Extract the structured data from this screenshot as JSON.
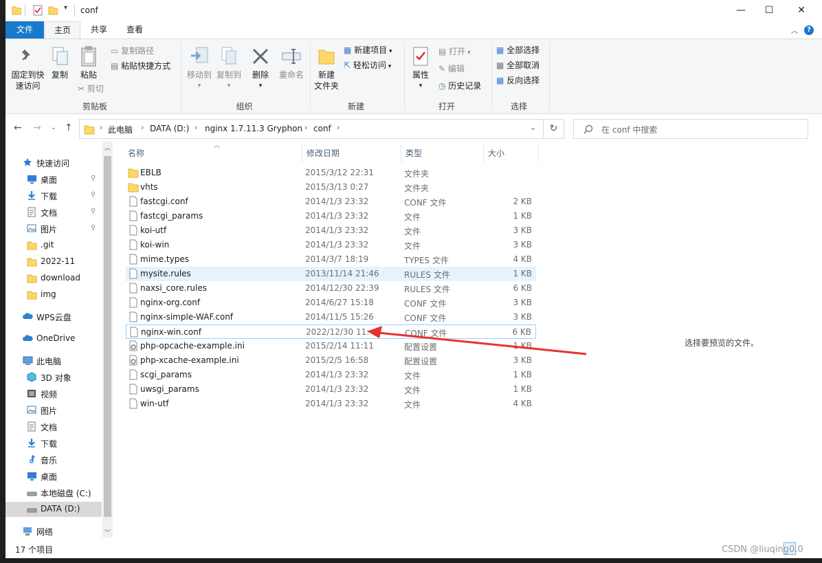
{
  "window": {
    "title": "conf",
    "minimize_glyph": "—",
    "maximize_glyph": "☐",
    "close_glyph": "✕"
  },
  "tabs": [
    {
      "label": "文件"
    },
    {
      "label": "主页"
    },
    {
      "label": "共享"
    },
    {
      "label": "查看"
    }
  ],
  "help": "?",
  "ribbon": {
    "clipboard": {
      "group_label": "剪贴板",
      "pin_label": "固定到快速访问",
      "pin_line1": "固定到快",
      "pin_line2": "速访问",
      "copy": "复制",
      "paste": "粘贴",
      "copy_path": "复制路径",
      "paste_shortcut": "粘贴快捷方式",
      "cut": "剪切"
    },
    "organize": {
      "group_label": "组织",
      "move_to": "移动到",
      "copy_to": "复制到",
      "delete": "删除",
      "rename": "重命名"
    },
    "new": {
      "group_label": "新建",
      "new_folder_line1": "新建",
      "new_folder_line2": "文件夹",
      "new_item": "新建项目",
      "easy_access": "轻松访问"
    },
    "open": {
      "group_label": "打开",
      "properties": "属性",
      "open": "打开",
      "edit": "编辑",
      "history": "历史记录"
    },
    "select": {
      "group_label": "选择",
      "select_all": "全部选择",
      "select_none": "全部取消",
      "invert": "反向选择"
    }
  },
  "address": {
    "crumbs": [
      "此电脑",
      "DATA (D:)",
      "nginx 1.7.11.3 Gryphon",
      "conf"
    ],
    "search_placeholder": "在 conf 中搜索"
  },
  "nav": {
    "items": [
      {
        "label": "快速访问",
        "icon": "star-icon"
      },
      {
        "label": "桌面",
        "icon": "desktop-icon",
        "pinned": true
      },
      {
        "label": "下载",
        "icon": "download-icon",
        "pinned": true
      },
      {
        "label": "文档",
        "icon": "document-icon",
        "pinned": true
      },
      {
        "label": "图片",
        "icon": "picture-icon",
        "pinned": true
      },
      {
        "label": ".git",
        "icon": "folder-icon"
      },
      {
        "label": "2022-11",
        "icon": "folder-icon"
      },
      {
        "label": "download",
        "icon": "folder-icon"
      },
      {
        "label": "img",
        "icon": "folder-icon"
      },
      {
        "label": "WPS云盘",
        "icon": "cloud-icon"
      },
      {
        "label": "OneDrive",
        "icon": "cloud-icon"
      },
      {
        "label": "此电脑",
        "icon": "computer-icon"
      },
      {
        "label": "3D 对象",
        "icon": "cube-icon"
      },
      {
        "label": "视频",
        "icon": "video-icon"
      },
      {
        "label": "图片",
        "icon": "picture-icon"
      },
      {
        "label": "文档",
        "icon": "document-icon"
      },
      {
        "label": "下载",
        "icon": "download-icon"
      },
      {
        "label": "音乐",
        "icon": "music-icon"
      },
      {
        "label": "桌面",
        "icon": "desktop-icon"
      },
      {
        "label": "本地磁盘 (C:)",
        "icon": "drive-icon"
      },
      {
        "label": "DATA (D:)",
        "icon": "drive-icon"
      },
      {
        "label": "网络",
        "icon": "network-icon"
      }
    ]
  },
  "columns": {
    "name": "名称",
    "date": "修改日期",
    "type": "类型",
    "size": "大小"
  },
  "files": [
    {
      "name": "EBLB",
      "date": "2015/3/12 22:31",
      "type": "文件夹",
      "size": "",
      "kind": "folder"
    },
    {
      "name": "vhts",
      "date": "2015/3/13 0:27",
      "type": "文件夹",
      "size": "",
      "kind": "folder"
    },
    {
      "name": "fastcgi.conf",
      "date": "2014/1/3 23:32",
      "type": "CONF 文件",
      "size": "2 KB",
      "kind": "file"
    },
    {
      "name": "fastcgi_params",
      "date": "2014/1/3 23:32",
      "type": "文件",
      "size": "1 KB",
      "kind": "file"
    },
    {
      "name": "koi-utf",
      "date": "2014/1/3 23:32",
      "type": "文件",
      "size": "3 KB",
      "kind": "file"
    },
    {
      "name": "koi-win",
      "date": "2014/1/3 23:32",
      "type": "文件",
      "size": "3 KB",
      "kind": "file"
    },
    {
      "name": "mime.types",
      "date": "2014/3/7 18:19",
      "type": "TYPES 文件",
      "size": "4 KB",
      "kind": "file"
    },
    {
      "name": "mysite.rules",
      "date": "2013/11/14 21:46",
      "type": "RULES 文件",
      "size": "1 KB",
      "kind": "file"
    },
    {
      "name": "naxsi_core.rules",
      "date": "2014/12/30 22:39",
      "type": "RULES 文件",
      "size": "6 KB",
      "kind": "file"
    },
    {
      "name": "nginx-org.conf",
      "date": "2014/6/27 15:18",
      "type": "CONF 文件",
      "size": "3 KB",
      "kind": "file"
    },
    {
      "name": "nginx-simple-WAF.conf",
      "date": "2014/11/5 15:26",
      "type": "CONF 文件",
      "size": "3 KB",
      "kind": "file"
    },
    {
      "name": "nginx-win.conf",
      "date": "2022/12/30 11:",
      "type": "CONF 文件",
      "size": "6 KB",
      "kind": "file"
    },
    {
      "name": "php-opcache-example.ini",
      "date": "2015/2/14 11:11",
      "type": "配置设置",
      "size": "1 KB",
      "kind": "ini"
    },
    {
      "name": "php-xcache-example.ini",
      "date": "2015/2/5 16:58",
      "type": "配置设置",
      "size": "3 KB",
      "kind": "ini"
    },
    {
      "name": "scgi_params",
      "date": "2014/1/3 23:32",
      "type": "文件",
      "size": "1 KB",
      "kind": "file"
    },
    {
      "name": "uwsgi_params",
      "date": "2014/1/3 23:32",
      "type": "文件",
      "size": "1 KB",
      "kind": "file"
    },
    {
      "name": "win-utf",
      "date": "2014/1/3 23:32",
      "type": "文件",
      "size": "4 KB",
      "kind": "file"
    }
  ],
  "preview_text": "选择要预览的文件。",
  "status": {
    "count": "17 个项目"
  },
  "watermark": "CSDN @liuqing0.0",
  "colors": {
    "accent": "#1979ca",
    "annotation_arrow": "#e8322d",
    "hover_row": "#e5f3ff"
  }
}
